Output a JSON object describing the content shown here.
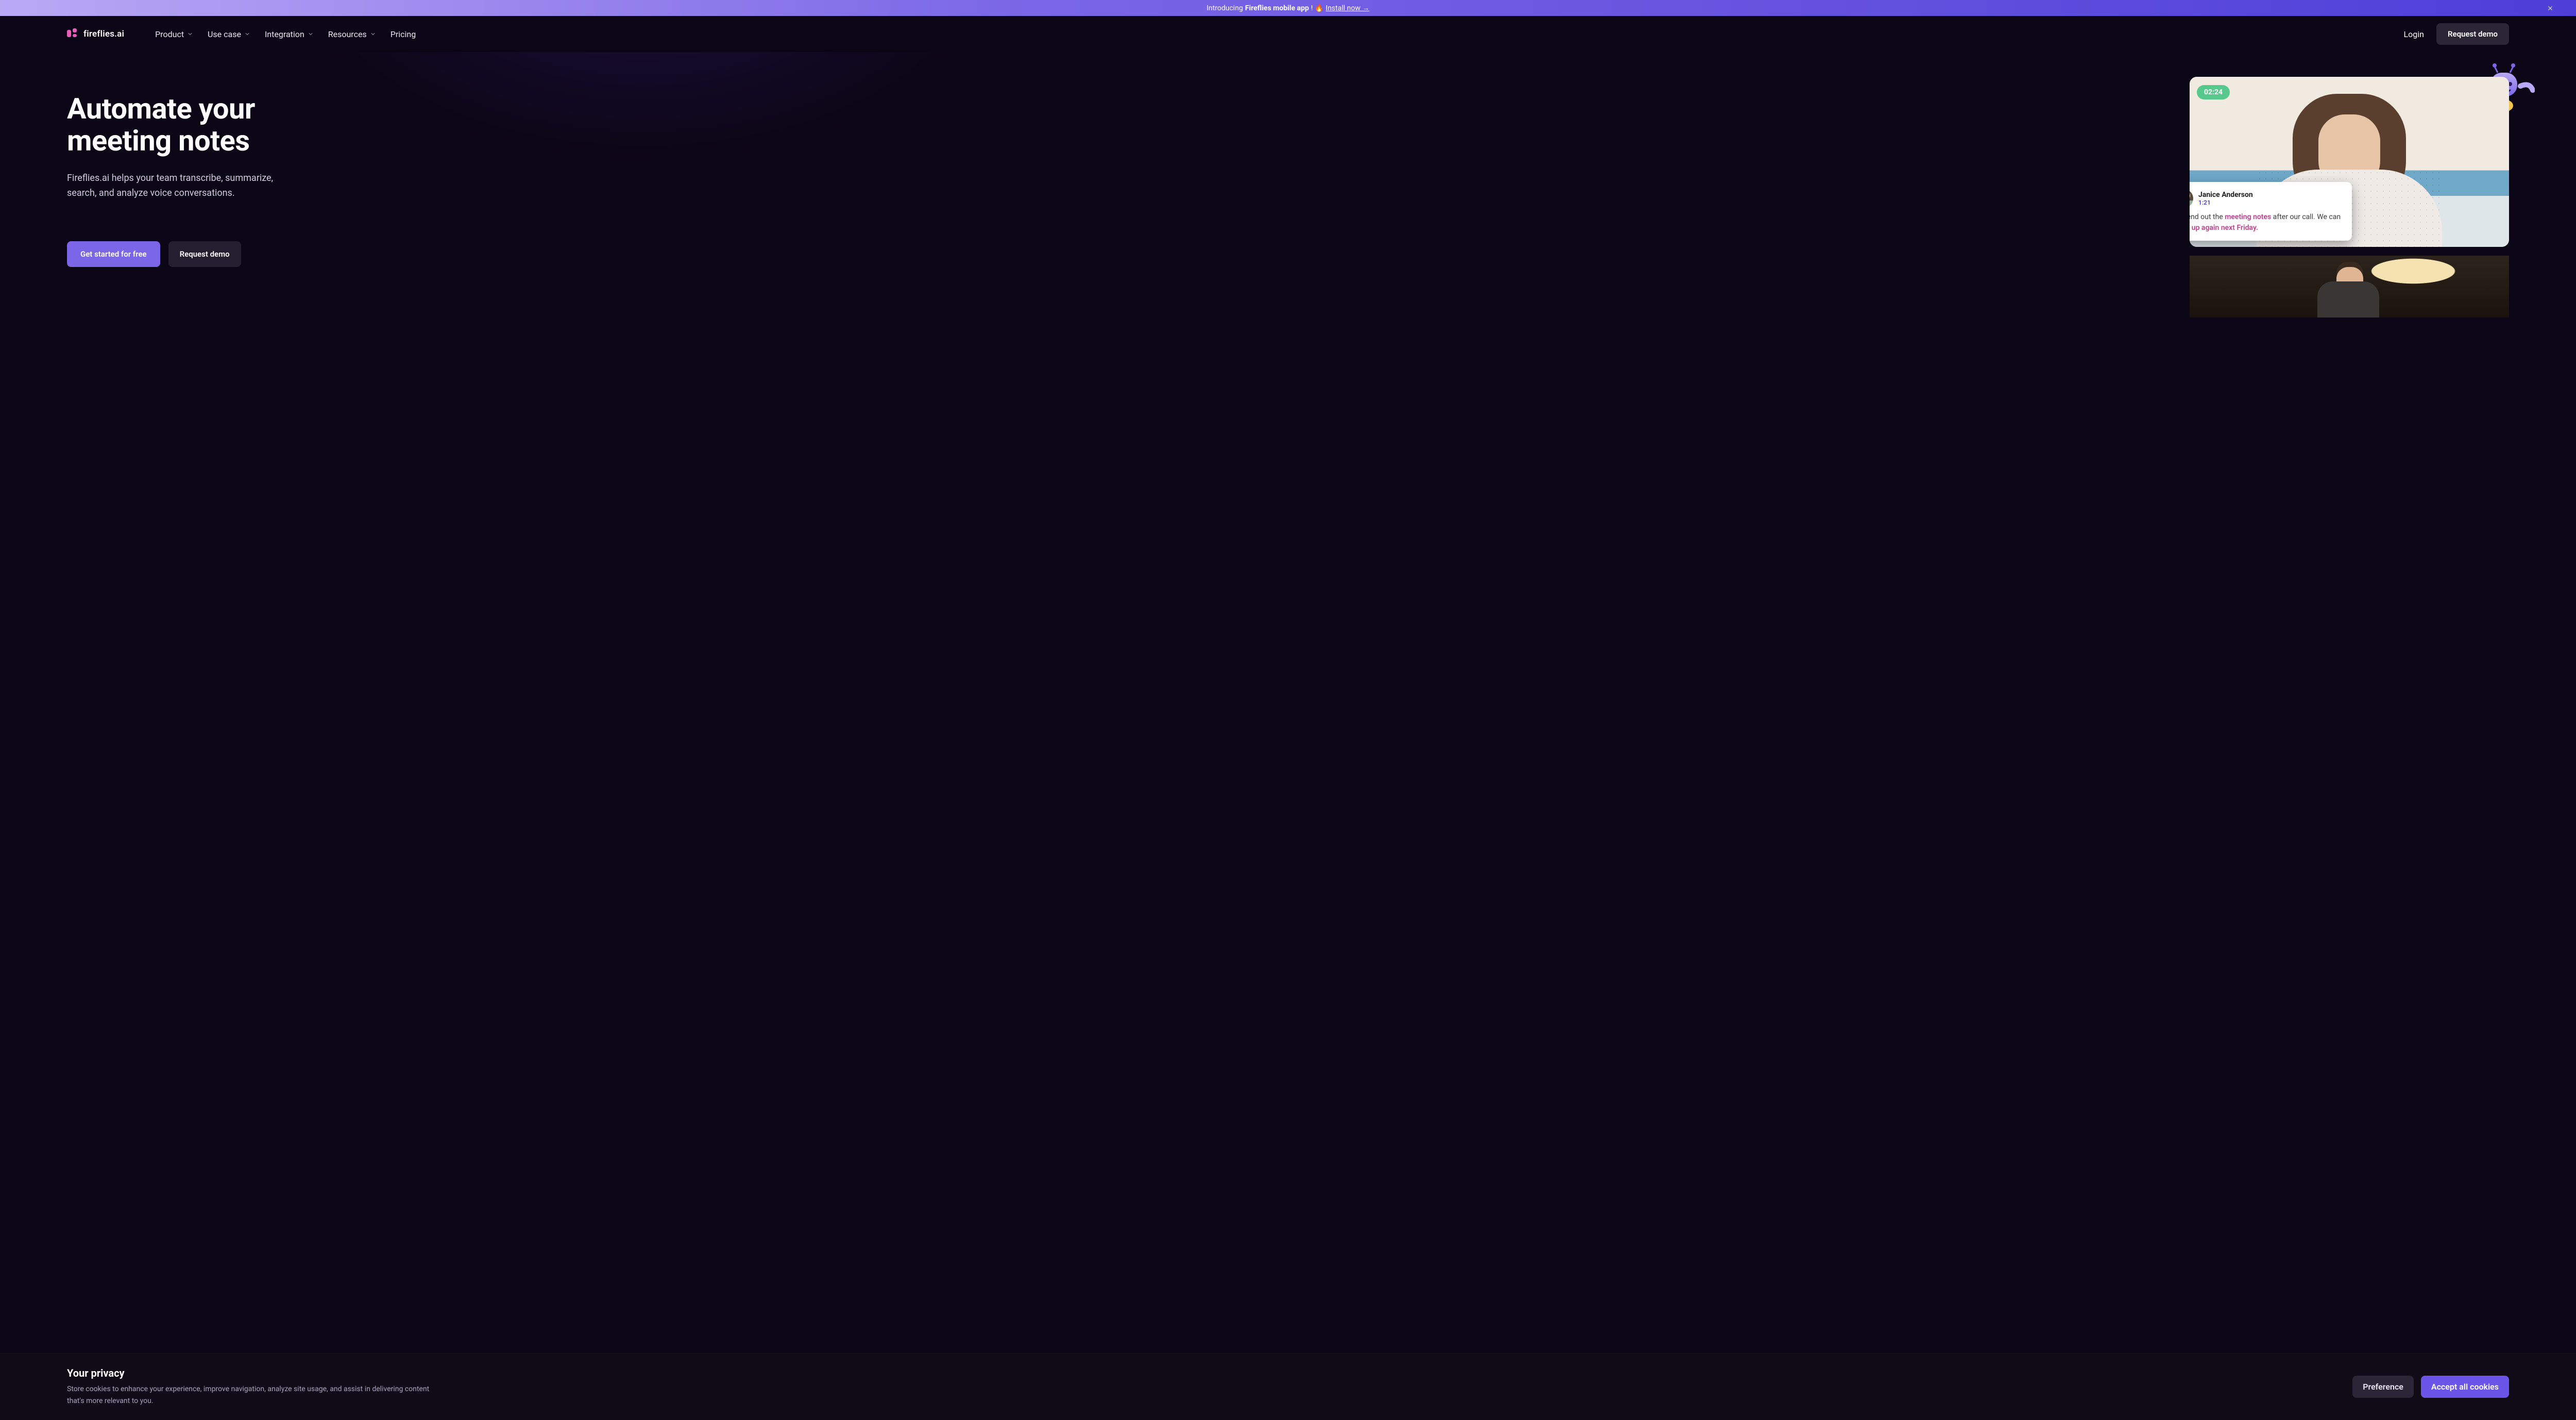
{
  "announce": {
    "intro": "Introducing ",
    "bold": "Fireflies mobile app",
    "suffix": "! 🔥 ",
    "link": "Install now →"
  },
  "brand": {
    "name": "fireflies.ai"
  },
  "nav": {
    "items": [
      {
        "label": "Product",
        "hasMenu": true
      },
      {
        "label": "Use case",
        "hasMenu": true
      },
      {
        "label": "Integration",
        "hasMenu": true
      },
      {
        "label": "Resources",
        "hasMenu": true
      },
      {
        "label": "Pricing",
        "hasMenu": false
      }
    ],
    "login": "Login",
    "request_demo": "Request demo"
  },
  "hero": {
    "title_l1": "Automate your",
    "title_l2": "meeting notes",
    "subtitle": "Fireflies.ai helps your team transcribe, summarize, search, and analyze voice conversations.",
    "cta_primary": "Get started for free",
    "cta_secondary": "Request demo"
  },
  "video": {
    "timestamp": "02:24",
    "speaker_name": "Janice Anderson",
    "speaker_time": "1:21",
    "line_pre": "I'll send out the ",
    "line_tag1": "meeting notes",
    "line_mid": " after our call. We can ",
    "line_tag2": "sync up again next Friday.",
    "line_post": ""
  },
  "cookies": {
    "title": "Your privacy",
    "body": "Store cookies to enhance your experience, improve navigation, analyze site usage, and assist in delivering content that's more relevant to you.",
    "pref": "Preference",
    "accept": "Accept all cookies"
  }
}
